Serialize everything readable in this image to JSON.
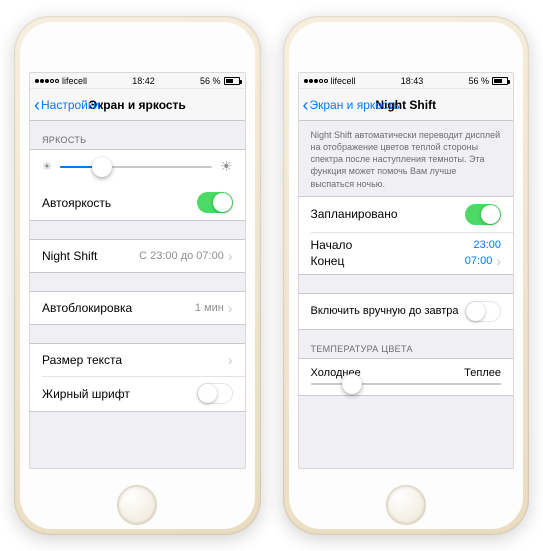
{
  "left": {
    "status": {
      "carrier": "lifecell",
      "time": "18:42",
      "battery": "56 %"
    },
    "nav": {
      "back": "Настройки",
      "title": "Экран и яркость"
    },
    "brightness_header": "ЯРКОСТЬ",
    "brightness_value_pct": 28,
    "auto_brightness": {
      "label": "Автояркость",
      "on": true
    },
    "night_shift": {
      "label": "Night Shift",
      "detail": "С 23:00 до 07:00"
    },
    "auto_lock": {
      "label": "Автоблокировка",
      "detail": "1 мин"
    },
    "text_size": {
      "label": "Размер текста"
    },
    "bold_text": {
      "label": "Жирный шрифт",
      "on": false
    }
  },
  "right": {
    "status": {
      "carrier": "lifecell",
      "time": "18:43",
      "battery": "56 %"
    },
    "nav": {
      "back": "Экран и яркость",
      "title": "Night Shift"
    },
    "description": "Night Shift автоматически переводит дисплей на отображение цветов теплой стороны спектра после наступления темноты. Эта функция может помочь Вам лучше выспаться ночью.",
    "scheduled": {
      "label": "Запланировано",
      "on": true
    },
    "schedule": {
      "start_label": "Начало",
      "start_value": "23:00",
      "end_label": "Конец",
      "end_value": "07:00"
    },
    "manual": {
      "label": "Включить вручную до завтра",
      "on": false
    },
    "temp_header": "ТЕМПЕРАТУРА ЦВЕТА",
    "temp_cold": "Холоднее",
    "temp_warm": "Теплее",
    "temp_value_pct": 22
  }
}
